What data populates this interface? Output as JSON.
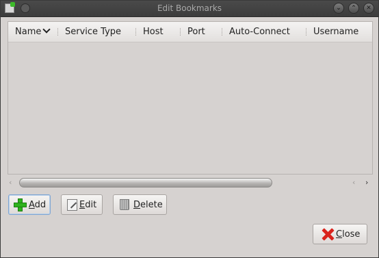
{
  "window": {
    "title": "Edit Bookmarks"
  },
  "titlebar": {
    "icons": [
      "app-icon",
      "menu-dot-icon",
      "minimize-icon",
      "maximize-icon",
      "close-window-icon"
    ],
    "minimize_glyph": "⌄",
    "maximize_glyph": "⌃",
    "close_glyph": "✕"
  },
  "table": {
    "columns": [
      "Name",
      "Service Type",
      "Host",
      "Port",
      "Auto-Connect",
      "Username"
    ],
    "sorted_column": "Name",
    "sort_icon": "chevron-down-icon",
    "rows": []
  },
  "scrollbar": {
    "left_arrow": "‹",
    "right_arrow": "‹",
    "far_right_arrow": "›",
    "thumb_fraction": 0.74
  },
  "buttons": {
    "add": {
      "label": "Add",
      "icon": "plus-icon"
    },
    "edit": {
      "label": "Edit",
      "icon": "edit-icon"
    },
    "delete": {
      "label": "Delete",
      "icon": "trash-icon"
    },
    "close": {
      "label": "Close",
      "icon": "close-x-icon"
    }
  },
  "colors": {
    "add_icon": "#2fb21d",
    "close_icon": "#d9231c",
    "window_bg": "#d6d2d0"
  }
}
